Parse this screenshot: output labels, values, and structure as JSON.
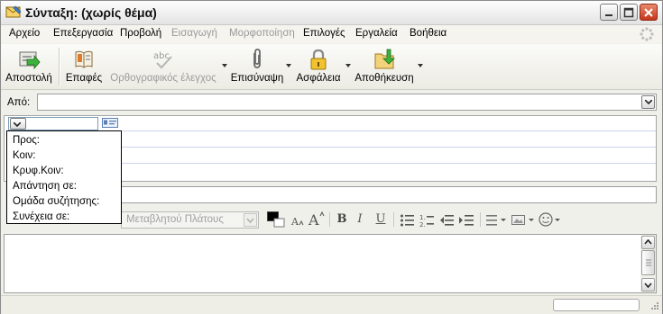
{
  "window": {
    "title": "Σύνταξη: (χωρίς θέμα)"
  },
  "menu": [
    "Αρχείο",
    "Επεξεργασία",
    "Προβολή",
    "Εισαγωγή",
    "Μορφοποίηση",
    "Επιλογές",
    "Εργαλεία",
    "Βοήθεια"
  ],
  "menu_disabled": [
    "Εισαγωγή",
    "Μορφοποίηση"
  ],
  "toolbar": {
    "send": "Αποστολή",
    "contacts": "Επαφές",
    "spell": "Ορθογραφικός έλεγχος",
    "attach": "Επισύναψη",
    "security": "Ασφάλεια",
    "save": "Αποθήκευση"
  },
  "spell_icon_text": "abc",
  "from": {
    "label": "Από:",
    "value": ""
  },
  "address_menu": [
    "Προς:",
    "Κοιν:",
    "Κρυφ.Κοιν:",
    "Απάντηση σε:",
    "Ομάδα συζήτησης:",
    "Συνέχεια σε:"
  ],
  "subject": {
    "value": ""
  },
  "format": {
    "font": "Μεταβλητού Πλάτους",
    "bold": "B",
    "italic": "I",
    "underline": "U"
  },
  "body": {
    "text": ""
  },
  "status": {
    "text": ""
  },
  "colors": {
    "accent": "#1f5fbf",
    "close": "#c4361a"
  }
}
